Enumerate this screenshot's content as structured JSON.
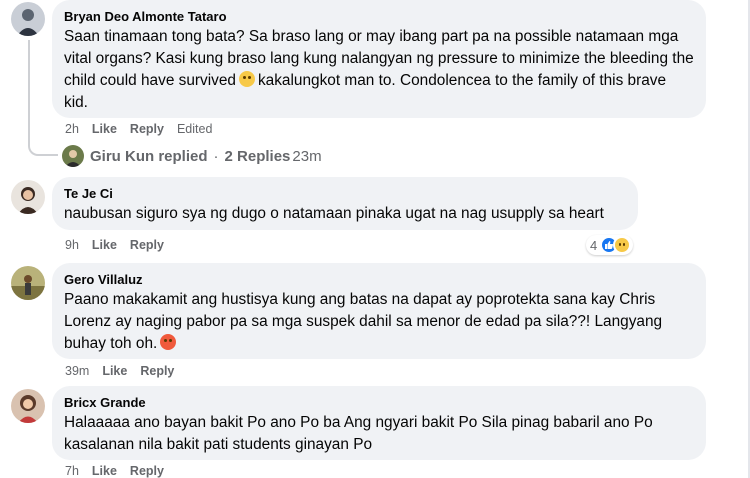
{
  "comments": [
    {
      "author": "Bryan Deo Almonte Tataro",
      "text_before": "Saan tinamaan tong bata? Sa braso lang or may ibang part pa na possible natamaan mga vital organs? Kasi kung braso lang kung nalangyan ng pressure to minimize the bleeding the child could have survived",
      "emoji": "sad-face-emoji",
      "text_after": "kakalungkot man to. Condolencea to the family of this brave kid.",
      "time": "2h",
      "like_label": "Like",
      "reply_label": "Reply",
      "edited_label": "Edited"
    },
    {
      "author": "Te Je Ci",
      "text": "naubusan siguro sya ng dugo o natamaan pinaka ugat na nag usupply sa heart",
      "time": "9h",
      "like_label": "Like",
      "reply_label": "Reply",
      "reaction_count": "4"
    },
    {
      "author": "Gero Villaluz",
      "text_before": "Paano makakamit ang hustisya kung ang batas na dapat ay poprotekta sana kay Chris Lorenz ay naging pabor pa sa mga suspek dahil sa menor de edad pa sila??! Langyang buhay toh oh.",
      "emoji": "angry-face-emoji",
      "time": "39m",
      "like_label": "Like",
      "reply_label": "Reply"
    },
    {
      "author": "Bricx Grande",
      "text": "Halaaaaa ano bayan bakit Po ano Po ba Ang ngyari bakit Po Sila pinag babaril ano Po kasalanan nila bakit pati students ginayan Po",
      "time": "7h",
      "like_label": "Like",
      "reply_label": "Reply"
    }
  ],
  "replies_summary": {
    "name": "Giru Kun replied",
    "separator": "·",
    "count": "2 Replies",
    "time": "23m"
  },
  "colors": {
    "bubble": "#f0f2f5",
    "meta_text": "#65676b",
    "like_blue": "#1877f2"
  }
}
